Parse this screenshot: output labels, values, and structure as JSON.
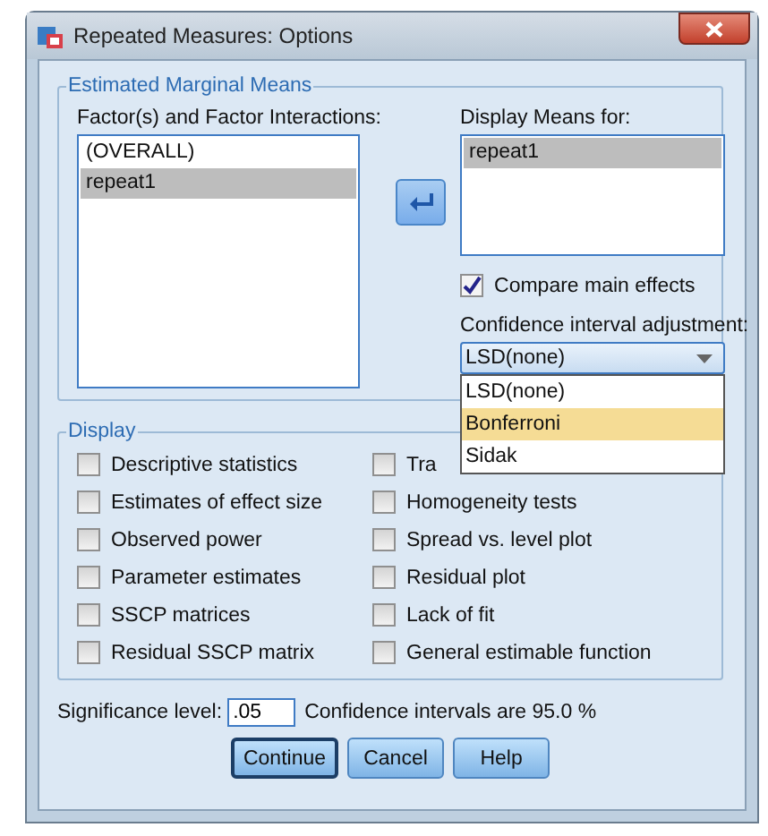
{
  "window": {
    "title": "Repeated Measures: Options"
  },
  "estimated_marginal_means": {
    "title": "Estimated Marginal Means",
    "factors_label": "Factor(s) and Factor Interactions:",
    "factors": [
      {
        "label": "(OVERALL)",
        "selected": false
      },
      {
        "label": "repeat1",
        "selected": true
      }
    ],
    "display_means_label": "Display Means for:",
    "display_means": [
      {
        "label": "repeat1",
        "selected": true
      }
    ],
    "compare_main_effects": {
      "label": "Compare main effects",
      "checked": true
    },
    "ci_adjustment_label": "Confidence interval adjustment:",
    "ci_adjustment": {
      "value": "LSD(none)",
      "expanded": true,
      "options": [
        {
          "label": "LSD(none)",
          "highlighted": false
        },
        {
          "label": "Bonferroni",
          "highlighted": true
        },
        {
          "label": "Sidak",
          "highlighted": false
        }
      ]
    }
  },
  "display": {
    "title": "Display",
    "options": [
      {
        "label": "Descriptive statistics",
        "checked": false
      },
      {
        "label": "Estimates of effect size",
        "checked": false
      },
      {
        "label": "Observed power",
        "checked": false
      },
      {
        "label": "Parameter estimates",
        "checked": false
      },
      {
        "label": "SSCP matrices",
        "checked": false
      },
      {
        "label": "Residual SSCP matrix",
        "checked": false
      },
      {
        "label": "Tra",
        "checked": false
      },
      {
        "label": "Homogeneity tests",
        "checked": false
      },
      {
        "label": "Spread vs. level plot",
        "checked": false
      },
      {
        "label": "Residual plot",
        "checked": false
      },
      {
        "label": "Lack of fit",
        "checked": false
      },
      {
        "label": "General estimable function",
        "checked": false
      }
    ]
  },
  "significance": {
    "label": "Significance level:",
    "value": ".05",
    "note": "Confidence intervals are 95.0 %"
  },
  "buttons": [
    {
      "label": "Continue",
      "default": true
    },
    {
      "label": "Cancel",
      "default": false
    },
    {
      "label": "Help",
      "default": false
    }
  ]
}
